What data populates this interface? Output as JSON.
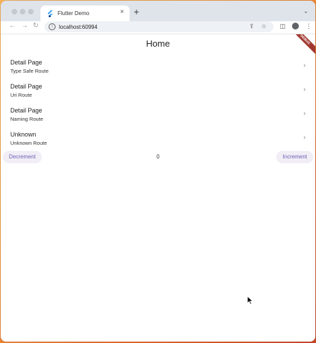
{
  "browser": {
    "tab_title": "Flutter Demo",
    "tab_close": "×",
    "new_tab": "+",
    "tab_menu": "⌄",
    "url": "localhost:60994",
    "icons": [
      "back-arrow-icon",
      "forward-arrow-icon",
      "reload-icon",
      "info-icon",
      "share-icon",
      "star-icon",
      "sidebar-icon",
      "profile-icon",
      "more-menu-icon"
    ]
  },
  "appbar": {
    "title": "Home",
    "debug_banner": "DEBUG"
  },
  "routes": [
    {
      "title": "Detail Page",
      "subtitle": "Type Safe Route"
    },
    {
      "title": "Detail Page",
      "subtitle": "Uri Route"
    },
    {
      "title": "Detail Page",
      "subtitle": "Naming Route"
    },
    {
      "title": "Unknown",
      "subtitle": "Unknown Route"
    }
  ],
  "counter": {
    "decrement_label": "Decrement",
    "value": "0",
    "increment_label": "Increment"
  },
  "colors": {
    "accent": "#6e5fb5",
    "pill_bg": "#f1eef6",
    "debug_banner": "#a0372e"
  }
}
